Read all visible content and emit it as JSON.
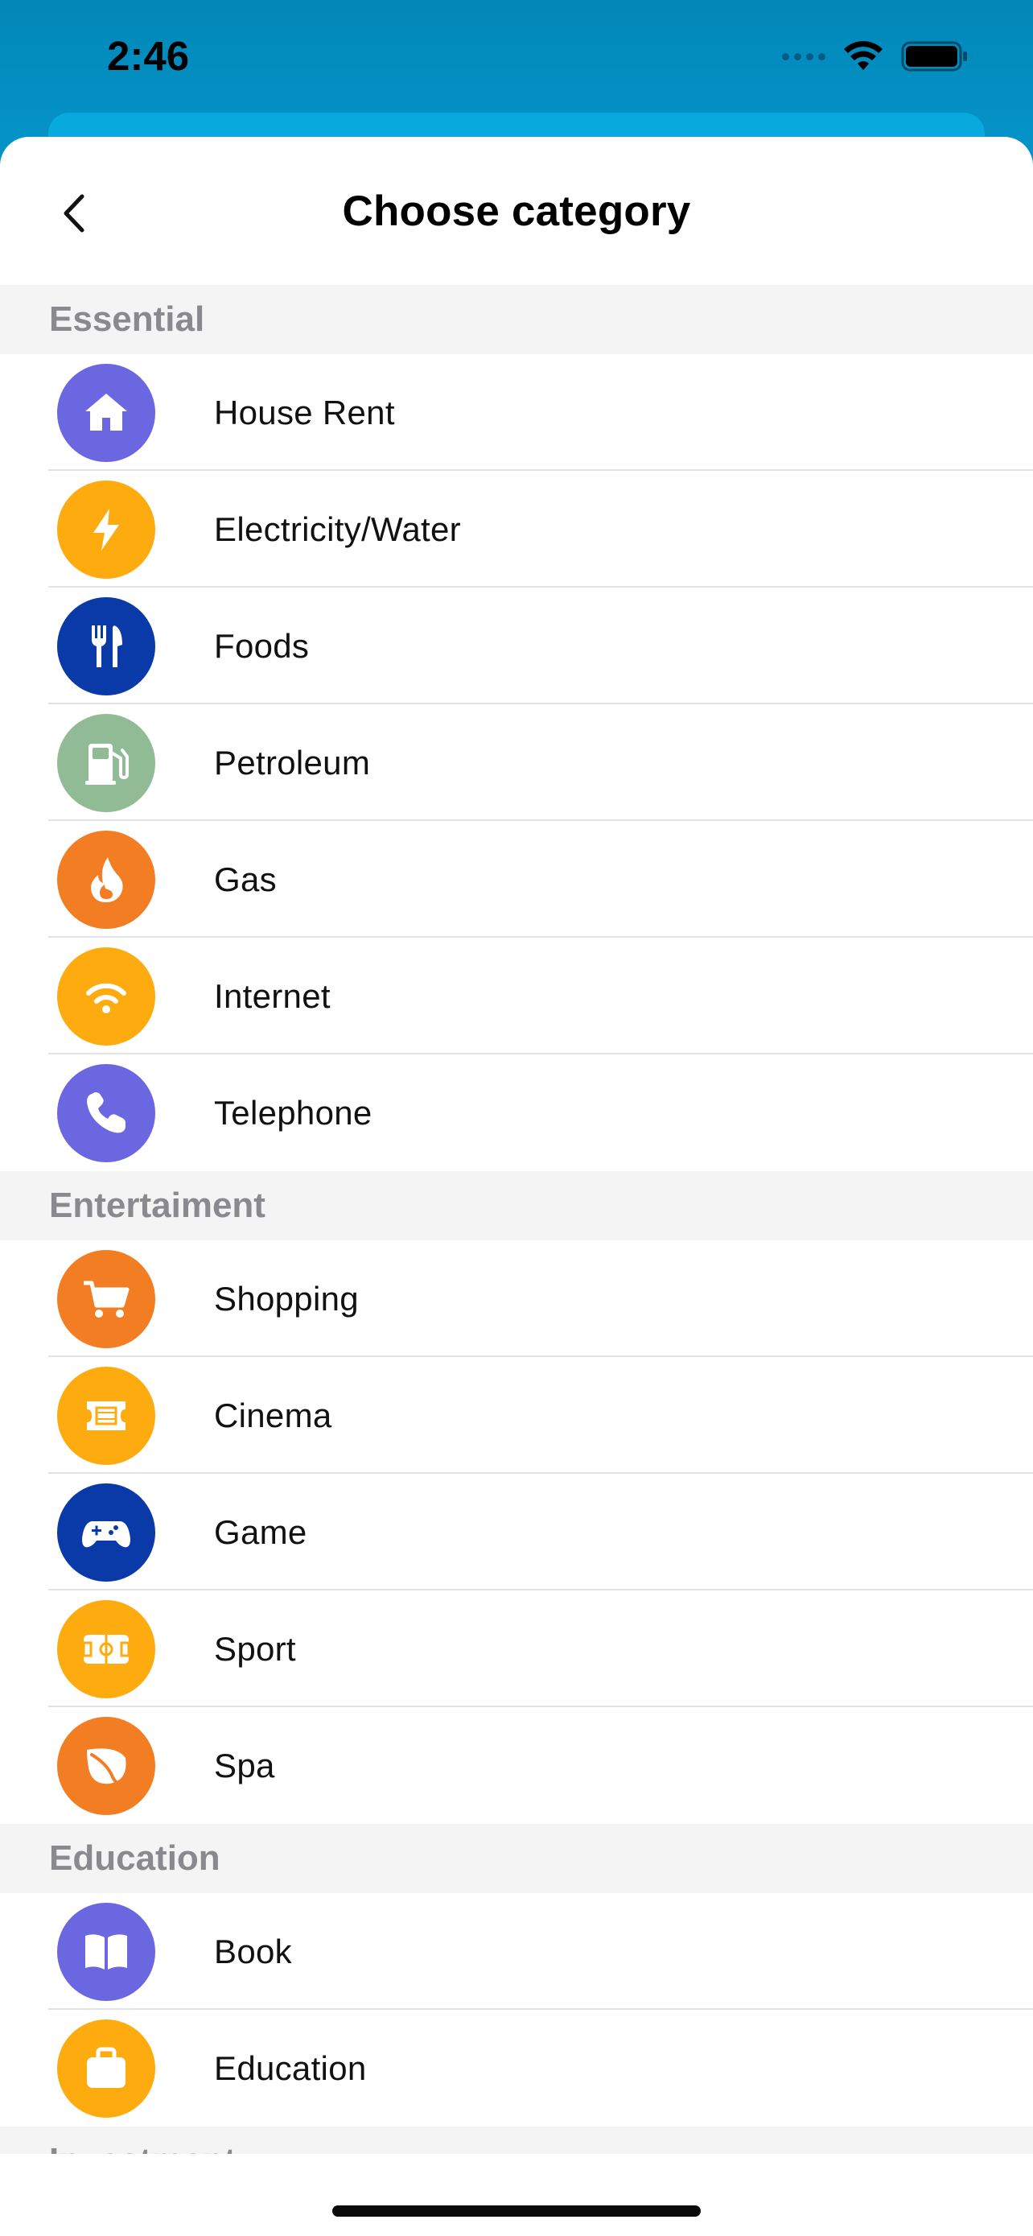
{
  "status": {
    "time": "2:46"
  },
  "nav": {
    "title": "Choose category",
    "back_icon": "chevron-left-icon"
  },
  "sections": [
    {
      "title": "Essential",
      "items": [
        {
          "label": "House Rent",
          "icon": "house-icon",
          "color": "#6b67e0"
        },
        {
          "label": "Electricity/Water",
          "icon": "lightning-icon",
          "color": "#fdab0f"
        },
        {
          "label": "Foods",
          "icon": "fork-knife-icon",
          "color": "#0a3aa8"
        },
        {
          "label": "Petroleum",
          "icon": "fuel-pump-icon",
          "color": "#90bb94"
        },
        {
          "label": "Gas",
          "icon": "flame-icon",
          "color": "#f27d22"
        },
        {
          "label": "Internet",
          "icon": "wifi-icon",
          "color": "#fdab0f"
        },
        {
          "label": "Telephone",
          "icon": "phone-icon",
          "color": "#6b67e0"
        }
      ]
    },
    {
      "title": "Entertaiment",
      "items": [
        {
          "label": "Shopping",
          "icon": "cart-icon",
          "color": "#f27d22"
        },
        {
          "label": "Cinema",
          "icon": "film-ticket-icon",
          "color": "#fdab0f"
        },
        {
          "label": "Game",
          "icon": "gamepad-icon",
          "color": "#0a3aa8"
        },
        {
          "label": "Sport",
          "icon": "sport-field-icon",
          "color": "#fdab0f"
        },
        {
          "label": "Spa",
          "icon": "leaf-icon",
          "color": "#f27d22"
        }
      ]
    },
    {
      "title": "Education",
      "items": [
        {
          "label": "Book",
          "icon": "book-icon",
          "color": "#6b67e0"
        },
        {
          "label": "Education",
          "icon": "bag-icon",
          "color": "#fdab0f"
        }
      ]
    },
    {
      "title": "Investment",
      "items": []
    }
  ]
}
